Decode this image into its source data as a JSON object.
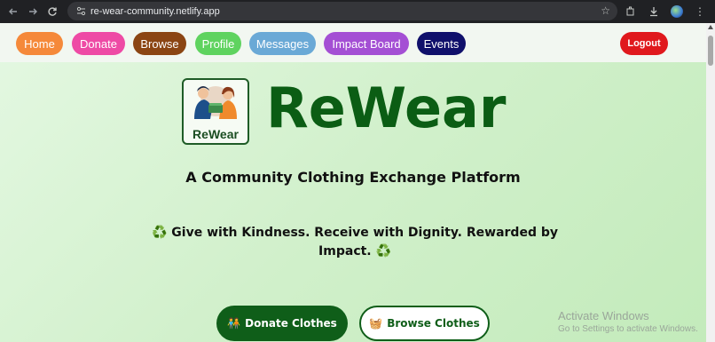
{
  "browser": {
    "url": "re-wear-community.netlify.app",
    "icons": [
      "back-icon",
      "forward-icon",
      "reload-icon",
      "site-info-icon",
      "bookmark-star-icon",
      "extensions-icon",
      "download-icon",
      "profile-avatar-icon"
    ]
  },
  "nav": {
    "items": [
      {
        "label": "Home",
        "color": "#f5893a"
      },
      {
        "label": "Donate",
        "color": "#ee4aa5"
      },
      {
        "label": "Browse",
        "color": "#8b4513"
      },
      {
        "label": "Profile",
        "color": "#5fd35f"
      },
      {
        "label": "Messages",
        "color": "#6aa9d6"
      },
      {
        "label": "Impact Board",
        "color": "#a44fd4"
      },
      {
        "label": "Events",
        "color": "#10106b"
      }
    ],
    "logout": {
      "label": "Logout",
      "color": "#e0191d"
    }
  },
  "hero": {
    "logo_text": "ReWear",
    "brand": "ReWear",
    "subtitle": "A Community Clothing Exchange Platform",
    "tagline_icon": "♻️",
    "tagline": "Give with Kindness. Receive with Dignity. Rewarded by Impact.",
    "brand_color": "#0b5d14"
  },
  "buttons": {
    "donate": {
      "icon": "🧑‍🤝‍🧑",
      "label": "Donate Clothes"
    },
    "browse": {
      "icon": "🧺",
      "label": "Browse Clothes"
    }
  },
  "watermark": {
    "title": "Activate Windows",
    "subtitle": "Go to Settings to activate Windows."
  }
}
